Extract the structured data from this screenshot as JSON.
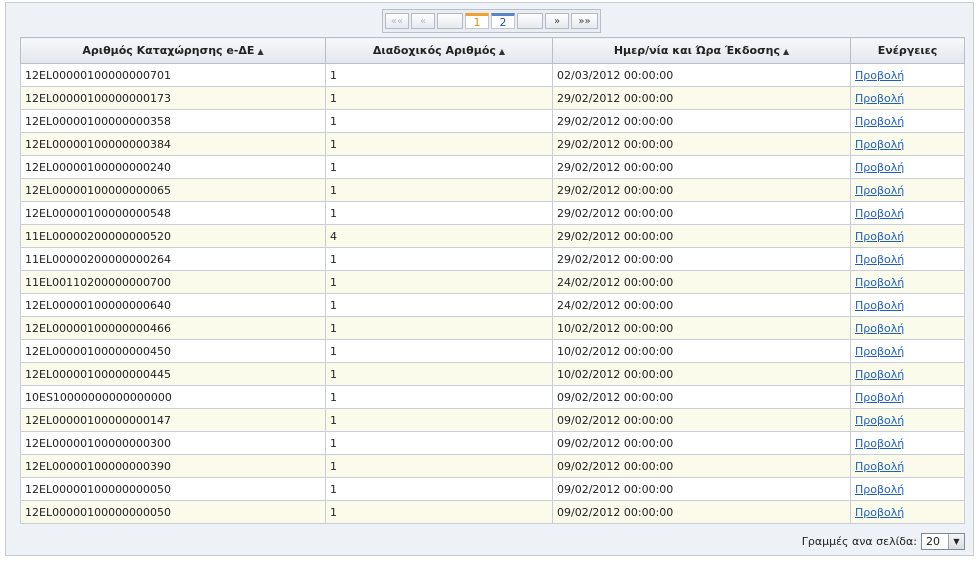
{
  "pager": {
    "first": "««",
    "prev": "«",
    "pages": [
      "1",
      "2"
    ],
    "next": "»",
    "last": "»»"
  },
  "table": {
    "headers": [
      "Αριθμός Καταχώρησης e-ΔΕ",
      "Διαδοχικός Αριθμός",
      "Ημερ/νία και Ώρα Έκδοσης",
      "Ενέργειες"
    ],
    "action_label": "Προβολή",
    "rows": [
      [
        "12EL00000100000000701",
        "1",
        "02/03/2012 00:00:00"
      ],
      [
        "12EL00000100000000173",
        "1",
        "29/02/2012 00:00:00"
      ],
      [
        "12EL00000100000000358",
        "1",
        "29/02/2012 00:00:00"
      ],
      [
        "12EL00000100000000384",
        "1",
        "29/02/2012 00:00:00"
      ],
      [
        "12EL00000100000000240",
        "1",
        "29/02/2012 00:00:00"
      ],
      [
        "12EL00000100000000065",
        "1",
        "29/02/2012 00:00:00"
      ],
      [
        "12EL00000100000000548",
        "1",
        "29/02/2012 00:00:00"
      ],
      [
        "11EL00000200000000520",
        "4",
        "29/02/2012 00:00:00"
      ],
      [
        "11EL00000200000000264",
        "1",
        "29/02/2012 00:00:00"
      ],
      [
        "11EL00110200000000700",
        "1",
        "24/02/2012 00:00:00"
      ],
      [
        "12EL00000100000000640",
        "1",
        "24/02/2012 00:00:00"
      ],
      [
        "12EL00000100000000466",
        "1",
        "10/02/2012 00:00:00"
      ],
      [
        "12EL00000100000000450",
        "1",
        "10/02/2012 00:00:00"
      ],
      [
        "12EL00000100000000445",
        "1",
        "10/02/2012 00:00:00"
      ],
      [
        "10ES10000000000000000",
        "1",
        "09/02/2012 00:00:00"
      ],
      [
        "12EL00000100000000147",
        "1",
        "09/02/2012 00:00:00"
      ],
      [
        "12EL00000100000000300",
        "1",
        "09/02/2012 00:00:00"
      ],
      [
        "12EL00000100000000390",
        "1",
        "09/02/2012 00:00:00"
      ],
      [
        "12EL00000100000000050",
        "1",
        "09/02/2012 00:00:00"
      ],
      [
        "12EL00000100000000050",
        "1",
        "09/02/2012 00:00:00"
      ]
    ]
  },
  "footer": {
    "rows_per_page_label": "Γραμμές ανα σελίδα:",
    "rows_per_page_value": "20"
  }
}
